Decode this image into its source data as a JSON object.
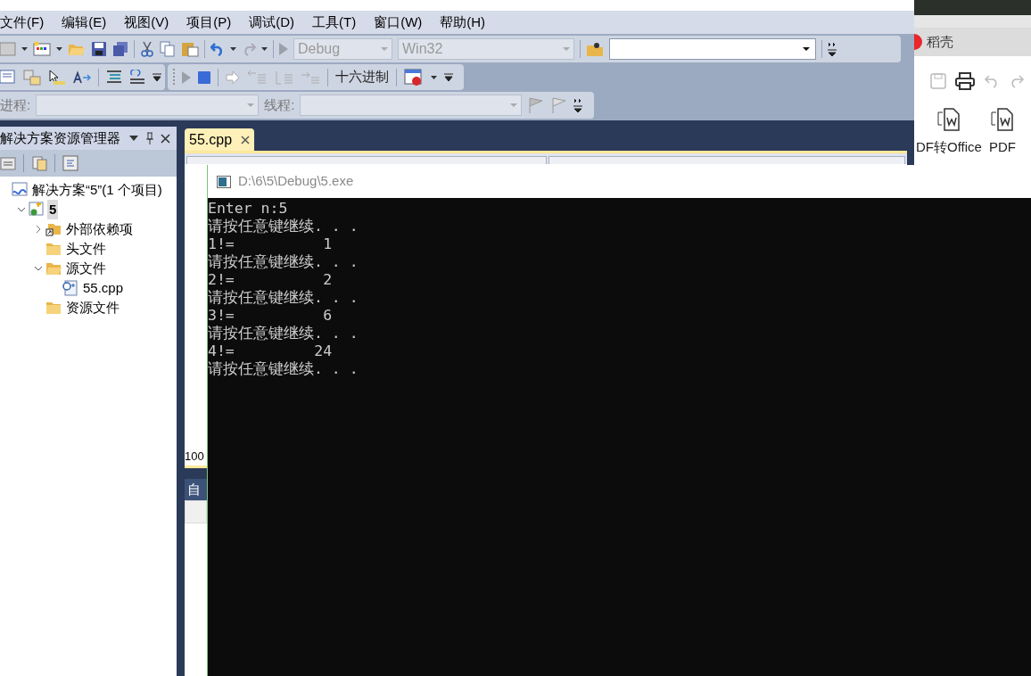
{
  "vs": {
    "menu": [
      "文件(F)",
      "编辑(E)",
      "视图(V)",
      "项目(P)",
      "调试(D)",
      "工具(T)",
      "窗口(W)",
      "帮助(H)"
    ],
    "toolbar": {
      "configuration": "Debug",
      "platform": "Win32",
      "hex_button": "十六进制",
      "process_label": "进程:",
      "thread_label": "线程:"
    },
    "solution_explorer": {
      "title": "解决方案资源管理器",
      "tree": [
        {
          "label": "解决方案“5”(1 个项目)",
          "kind": "solution",
          "selected": false,
          "children": [
            {
              "label": "5",
              "kind": "project",
              "selected": true,
              "expanded": true,
              "children": [
                {
                  "label": "外部依赖项",
                  "kind": "dependencies",
                  "selected": false,
                  "expanded": false
                },
                {
                  "label": "头文件",
                  "kind": "folder",
                  "selected": false
                },
                {
                  "label": "源文件",
                  "kind": "folder",
                  "selected": false,
                  "expanded": true,
                  "children": [
                    {
                      "label": "55.cpp",
                      "kind": "file",
                      "selected": false
                    }
                  ]
                },
                {
                  "label": "资源文件",
                  "kind": "folder",
                  "selected": false
                }
              ]
            }
          ]
        }
      ]
    },
    "editor": {
      "tabs": [
        {
          "label": "55.cpp",
          "selected": true
        }
      ],
      "zoom": "100"
    },
    "bottom_panel": {
      "title": "自"
    }
  },
  "console": {
    "title": "D:\\6\\5\\Debug\\5.exe",
    "lines": [
      "Enter n:5",
      "请按任意键继续. . .",
      "1!=          1",
      "请按任意键继续. . .",
      "2!=          2",
      "请按任意键继续. . .",
      "3!=          6",
      "请按任意键继续. . .",
      "4!=         24",
      "请按任意键继续. . ."
    ]
  },
  "wps": {
    "tab": "稻壳",
    "ribbon": [
      "DF转Office",
      "PDF"
    ]
  }
}
